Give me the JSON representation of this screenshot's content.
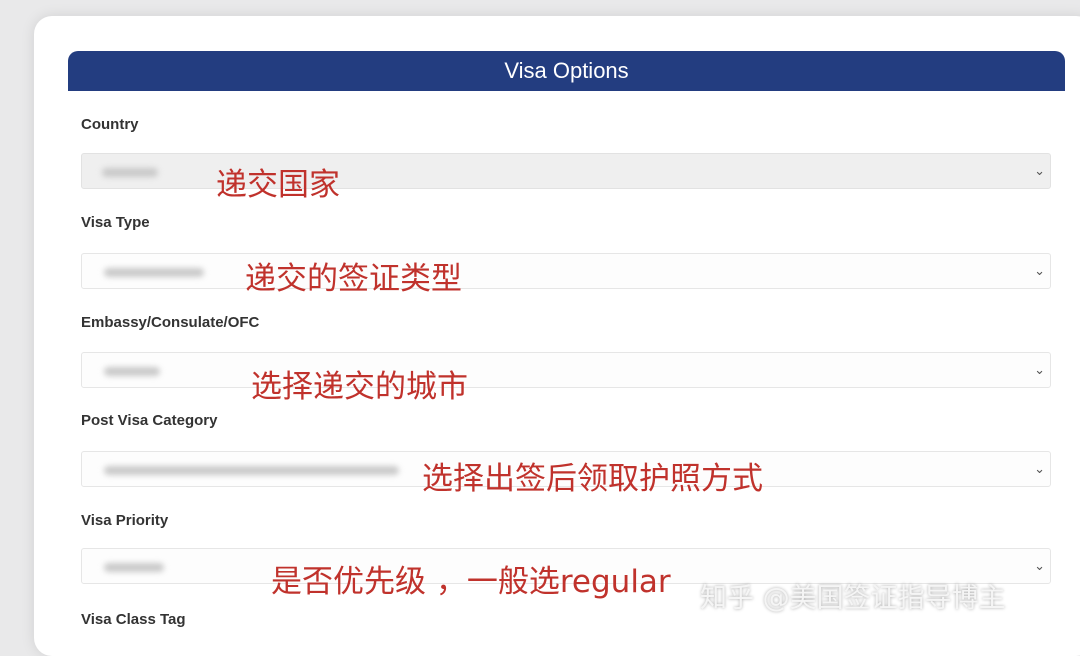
{
  "panel": {
    "title": "Visa Options"
  },
  "fields": [
    {
      "label": "Country",
      "annotation": "递交国家",
      "chevron": "⌄"
    },
    {
      "label": "Visa Type",
      "annotation": "递交的签证类型",
      "chevron": "⌄"
    },
    {
      "label": "Embassy/Consulate/OFC",
      "annotation": "选择递交的城市",
      "chevron": "⌄"
    },
    {
      "label": "Post Visa Category",
      "annotation": "选择出签后领取护照方式",
      "chevron": "⌄"
    },
    {
      "label": "Visa Priority",
      "annotation": "是否优先级 ，一般选regular",
      "chevron": "⌄"
    },
    {
      "label": "Visa Class Tag"
    }
  ],
  "watermark": "知乎 @美国签证指导博主"
}
